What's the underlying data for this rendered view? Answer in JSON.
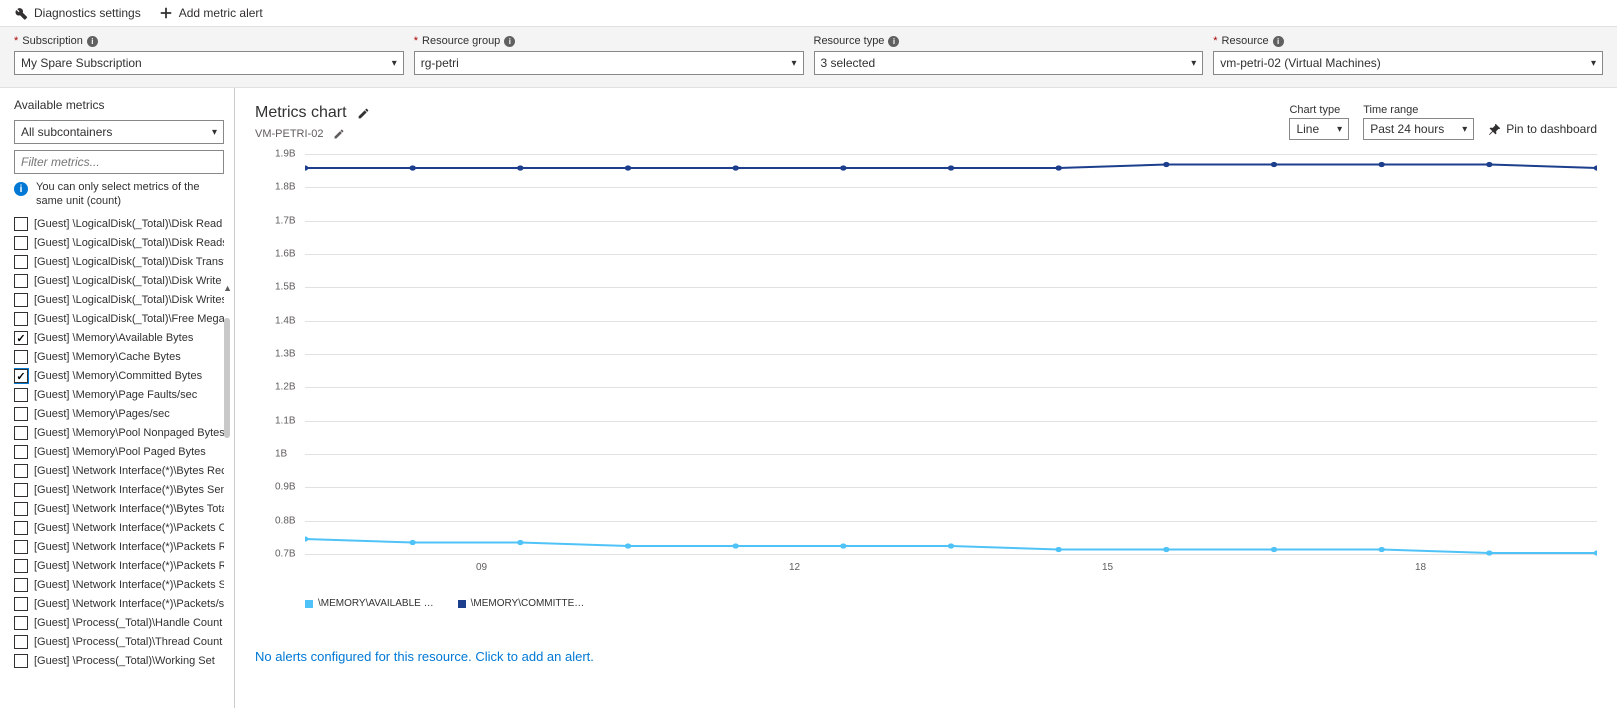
{
  "toolbar": {
    "diag": "Diagnostics settings",
    "add_alert": "Add metric alert"
  },
  "filters": {
    "subscription": {
      "label": "Subscription",
      "value": "My Spare Subscription"
    },
    "rg": {
      "label": "Resource group",
      "value": "rg-petri"
    },
    "rtype": {
      "label": "Resource type",
      "value": "3 selected"
    },
    "resource": {
      "label": "Resource",
      "value": "vm-petri-02 (Virtual Machines)"
    }
  },
  "sidebar": {
    "title": "Available metrics",
    "subcontainer": "All subcontainers",
    "filter_placeholder": "Filter metrics...",
    "info": "You can only select metrics of the same unit (count)",
    "items": [
      {
        "label": "[Guest] \\LogicalDisk(_Total)\\Disk Read Bytes/s",
        "checked": false
      },
      {
        "label": "[Guest] \\LogicalDisk(_Total)\\Disk Reads/sec",
        "checked": false
      },
      {
        "label": "[Guest] \\LogicalDisk(_Total)\\Disk Transfers/sec",
        "checked": false
      },
      {
        "label": "[Guest] \\LogicalDisk(_Total)\\Disk Write Bytes/s",
        "checked": false
      },
      {
        "label": "[Guest] \\LogicalDisk(_Total)\\Disk Writes/sec",
        "checked": false
      },
      {
        "label": "[Guest] \\LogicalDisk(_Total)\\Free Megabytes",
        "checked": false
      },
      {
        "label": "[Guest] \\Memory\\Available Bytes",
        "checked": true
      },
      {
        "label": "[Guest] \\Memory\\Cache Bytes",
        "checked": false
      },
      {
        "label": "[Guest] \\Memory\\Committed Bytes",
        "checked": true,
        "focus": true
      },
      {
        "label": "[Guest] \\Memory\\Page Faults/sec",
        "checked": false
      },
      {
        "label": "[Guest] \\Memory\\Pages/sec",
        "checked": false
      },
      {
        "label": "[Guest] \\Memory\\Pool Nonpaged Bytes",
        "checked": false
      },
      {
        "label": "[Guest] \\Memory\\Pool Paged Bytes",
        "checked": false
      },
      {
        "label": "[Guest] \\Network Interface(*)\\Bytes Received/",
        "checked": false
      },
      {
        "label": "[Guest] \\Network Interface(*)\\Bytes Sent/sec",
        "checked": false
      },
      {
        "label": "[Guest] \\Network Interface(*)\\Bytes Total/sec",
        "checked": false
      },
      {
        "label": "[Guest] \\Network Interface(*)\\Packets Outbou",
        "checked": false
      },
      {
        "label": "[Guest] \\Network Interface(*)\\Packets Receive",
        "checked": false
      },
      {
        "label": "[Guest] \\Network Interface(*)\\Packets Receive",
        "checked": false
      },
      {
        "label": "[Guest] \\Network Interface(*)\\Packets Sent/se",
        "checked": false
      },
      {
        "label": "[Guest] \\Network Interface(*)\\Packets/sec",
        "checked": false
      },
      {
        "label": "[Guest] \\Process(_Total)\\Handle Count",
        "checked": false
      },
      {
        "label": "[Guest] \\Process(_Total)\\Thread Count",
        "checked": false
      },
      {
        "label": "[Guest] \\Process(_Total)\\Working Set",
        "checked": false
      }
    ]
  },
  "chart": {
    "title": "Metrics chart",
    "subtitle": "VM-PETRI-02",
    "type_label": "Chart type",
    "type_value": "Line",
    "range_label": "Time range",
    "range_value": "Past 24 hours",
    "pin": "Pin to dashboard",
    "legend": [
      "\\MEMORY\\AVAILABLE …",
      "\\MEMORY\\COMMITTE…"
    ],
    "alert": "No alerts configured for this resource. Click to add an alert."
  },
  "chart_data": {
    "type": "line",
    "xlabel": "",
    "ylabel": "",
    "ylim": [
      0.7,
      1.9
    ],
    "yticks": [
      "1.9B",
      "1.8B",
      "1.7B",
      "1.6B",
      "1.5B",
      "1.4B",
      "1.3B",
      "1.2B",
      "1.1B",
      "1B",
      "0.9B",
      "0.8B",
      "0.7B"
    ],
    "xticks": [
      "09",
      "12",
      "15",
      "18"
    ],
    "series": [
      {
        "name": "\\MEMORY\\COMMITTED BYTES",
        "color": "#1c3e8c",
        "values": [
          1.86,
          1.86,
          1.86,
          1.86,
          1.86,
          1.86,
          1.86,
          1.86,
          1.87,
          1.87,
          1.87,
          1.87,
          1.86
        ]
      },
      {
        "name": "\\MEMORY\\AVAILABLE BYTES",
        "color": "#4fc3f7",
        "values": [
          0.8,
          0.79,
          0.79,
          0.78,
          0.78,
          0.78,
          0.78,
          0.77,
          0.77,
          0.77,
          0.77,
          0.76,
          0.76
        ]
      }
    ]
  }
}
